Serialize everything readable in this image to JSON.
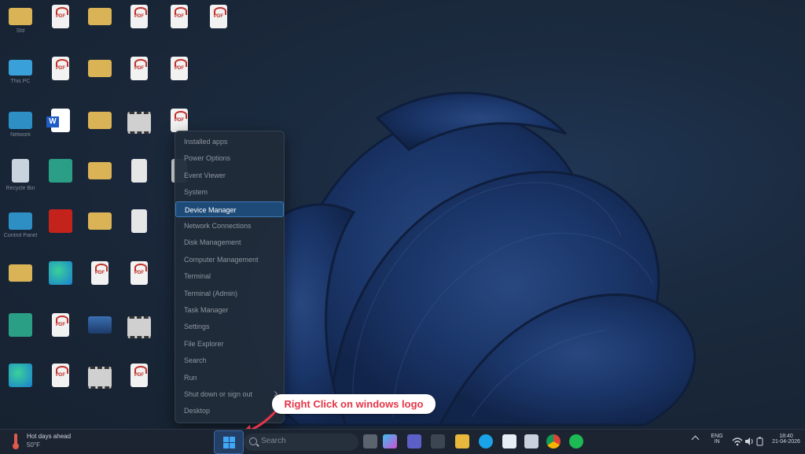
{
  "desktop": {
    "icons": [
      {
        "label": "Sfd",
        "kind": "folder"
      },
      {
        "label": "",
        "kind": "pdf"
      },
      {
        "label": "",
        "kind": "folder"
      },
      {
        "label": "",
        "kind": "pdf"
      },
      {
        "label": "",
        "kind": "pdf"
      },
      {
        "label": "",
        "kind": "pdf"
      },
      {
        "label": "This PC",
        "kind": "monitor"
      },
      {
        "label": "",
        "kind": "pdf"
      },
      {
        "label": "",
        "kind": "folder"
      },
      {
        "label": "",
        "kind": "pdf"
      },
      {
        "label": "",
        "kind": "pdf"
      },
      {
        "label": "Network",
        "kind": "net"
      },
      {
        "label": "",
        "kind": "word"
      },
      {
        "label": "",
        "kind": "folder"
      },
      {
        "label": "",
        "kind": "film"
      },
      {
        "label": "",
        "kind": "pdf"
      },
      {
        "label": "Recycle Bin",
        "kind": "bin"
      },
      {
        "label": "",
        "kind": "green"
      },
      {
        "label": "",
        "kind": "folder"
      },
      {
        "label": "",
        "kind": "doc"
      },
      {
        "label": "",
        "kind": "doc"
      },
      {
        "label": "Control Panel",
        "kind": "net"
      },
      {
        "label": "",
        "kind": "acrobat"
      },
      {
        "label": "",
        "kind": "folder"
      },
      {
        "label": "",
        "kind": "doc"
      },
      {
        "label": "",
        "kind": "folder"
      },
      {
        "label": "",
        "kind": "edge"
      },
      {
        "label": "",
        "kind": "pdf"
      },
      {
        "label": "",
        "kind": "pdf"
      },
      {
        "label": "",
        "kind": "green"
      },
      {
        "label": "",
        "kind": "pdf"
      },
      {
        "label": "",
        "kind": "photo"
      },
      {
        "label": "",
        "kind": "film"
      },
      {
        "label": "",
        "kind": "edge"
      },
      {
        "label": "",
        "kind": "pdf"
      },
      {
        "label": "",
        "kind": "film"
      },
      {
        "label": "",
        "kind": "pdf"
      }
    ]
  },
  "context_menu": {
    "items": [
      {
        "label": "Installed apps",
        "selected": false
      },
      {
        "label": "Power Options",
        "selected": false
      },
      {
        "label": "Event Viewer",
        "selected": false
      },
      {
        "label": "System",
        "selected": false
      },
      {
        "label": "Device Manager",
        "selected": true
      },
      {
        "label": "Network Connections",
        "selected": false
      },
      {
        "label": "Disk Management",
        "selected": false
      },
      {
        "label": "Computer Management",
        "selected": false
      },
      {
        "label": "Terminal",
        "selected": false
      },
      {
        "label": "Terminal (Admin)",
        "selected": false
      },
      {
        "label": "Task Manager",
        "selected": false
      },
      {
        "label": "Settings",
        "selected": false
      },
      {
        "label": "File Explorer",
        "selected": false
      },
      {
        "label": "Search",
        "selected": false
      },
      {
        "label": "Run",
        "selected": false
      },
      {
        "label": "Shut down or sign out",
        "selected": false,
        "has_submenu": true
      },
      {
        "label": "Desktop",
        "selected": false
      }
    ]
  },
  "annotation": {
    "callout_text": "Right Click on windows logo",
    "color": "#e53547"
  },
  "taskbar": {
    "weather_title": "Hot days ahead",
    "weather_temp": "50°F",
    "search_placeholder": "Search",
    "apps": [
      "task-view-icon",
      "copilot-icon",
      "teams-icon",
      "store-icon",
      "file-explorer-icon",
      "skype-icon",
      "notepad-icon",
      "snipping-icon",
      "chrome-icon",
      "spotify-icon"
    ],
    "tray": {
      "lang_1": "ENG",
      "lang_2": "IN",
      "time": "18:40",
      "date": "21-04-2026"
    },
    "accent": "#3fa7f5"
  }
}
